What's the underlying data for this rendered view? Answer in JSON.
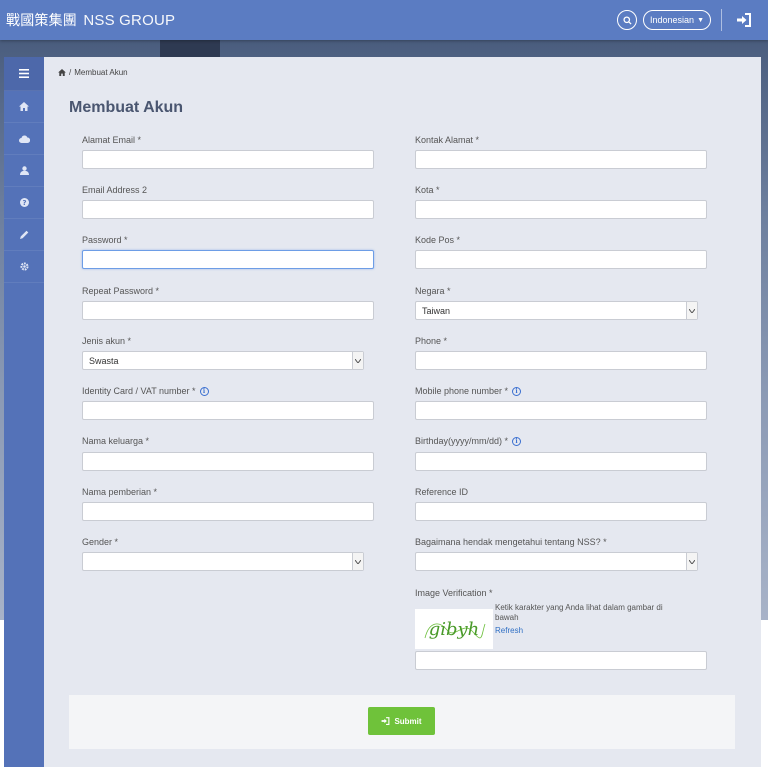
{
  "header": {
    "brand_cn": "戰國策集團",
    "brand_en": "NSS GROUP",
    "language": "Indonesian"
  },
  "breadcrumb": {
    "sep": "/",
    "current": "Membuat Akun"
  },
  "page_title": "Membuat Akun",
  "form": {
    "email_label": "Alamat Email *",
    "email2_label": "Email Address 2",
    "password_label": "Password *",
    "repeat_password_label": "Repeat Password *",
    "account_type_label": "Jenis akun *",
    "account_type_value": "Swasta",
    "identity_label": "Identity Card / VAT number *",
    "family_name_label": "Nama keluarga *",
    "given_name_label": "Nama pemberian *",
    "gender_label": "Gender *",
    "gender_value": "",
    "contact_address_label": "Kontak Alamat *",
    "city_label": "Kota *",
    "postal_label": "Kode Pos *",
    "country_label": "Negara *",
    "country_value": "Taiwan",
    "phone_label": "Phone *",
    "mobile_label": "Mobile phone number *",
    "birthday_label": "Birthday(yyyy/mm/dd) *",
    "reference_label": "Reference ID",
    "source_label": "Bagaimana hendak mengetahui tentang NSS? *",
    "source_value": "",
    "image_verification_label": "Image Verification *",
    "captcha_hint": "Ketik karakter yang Anda lihat dalam gambar di bawah",
    "captcha_refresh": "Refresh",
    "captcha_text": "gibyh",
    "submit_label": "Submit"
  },
  "colors": {
    "header": "#5b7cc2",
    "sidebar": "#5472b8",
    "panel": "#e5e8f0",
    "submit": "#6fc23a",
    "link": "#2f6fc4"
  }
}
